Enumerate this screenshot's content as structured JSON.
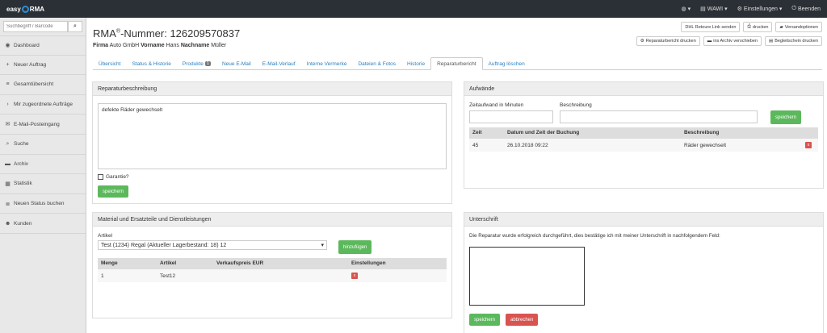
{
  "topbar": {
    "logo_left": "easy",
    "logo_right": "RMA",
    "nav": [
      {
        "icon": "globe-icon",
        "glyph": "◍",
        "label": ""
      },
      {
        "icon": "wawi-icon",
        "glyph": "▤",
        "label": "WAWI"
      },
      {
        "icon": "gear-icon",
        "glyph": "⚙",
        "label": "Einstellungen"
      },
      {
        "icon": "power-icon",
        "glyph": "⏻",
        "label": "Beenden"
      }
    ]
  },
  "sidebar": {
    "search_placeholder": "Suchbegriff / Barcode",
    "items": [
      {
        "icon": "dashboard-icon",
        "glyph": "◉",
        "label": "Dashboard"
      },
      {
        "icon": "plus-icon",
        "glyph": "+",
        "label": "Neuer Auftrag"
      },
      {
        "icon": "list-icon",
        "glyph": "≡",
        "label": "Gesamtübersicht"
      },
      {
        "icon": "chevron-right-icon",
        "glyph": "›",
        "label": "Mir zugeordnete Aufträge"
      },
      {
        "icon": "envelope-icon",
        "glyph": "✉",
        "label": "E-Mail-Posteingang"
      },
      {
        "icon": "search-icon",
        "glyph": "⌕",
        "label": "Suche"
      },
      {
        "icon": "archive-icon",
        "glyph": "▬",
        "label": "Archiv"
      },
      {
        "icon": "chart-icon",
        "glyph": "▦",
        "label": "Statistik"
      },
      {
        "icon": "list-icon",
        "glyph": "≣",
        "label": "Neuen Status buchen"
      },
      {
        "icon": "users-icon",
        "glyph": "☻",
        "label": "Kunden"
      }
    ]
  },
  "header": {
    "title_prefix": "RMA",
    "title_reg": "®",
    "title_suffix": "-Nummer: 126209570837",
    "firma_label": "Firma",
    "firma": "Auto GmbH",
    "vorname_label": "Vorname",
    "vorname": "Hans",
    "nachname_label": "Nachname",
    "nachname": "Müller",
    "buttons_row1": [
      {
        "label": "DHL Retoure Link senden",
        "glyph": ""
      },
      {
        "label": "drucken",
        "glyph": "⎙"
      },
      {
        "label": "Versandoptionen",
        "glyph": "▰"
      }
    ],
    "buttons_row2": [
      {
        "label": "Reparaturbericht drucken",
        "glyph": "⚙"
      },
      {
        "label": "ins Archiv verschieben",
        "glyph": "▬"
      },
      {
        "label": "Begleitschein drucken",
        "glyph": "▤"
      }
    ]
  },
  "tabs": [
    {
      "label": "Übersicht"
    },
    {
      "label": "Status & Historie"
    },
    {
      "label": "Produkte",
      "badge": "1"
    },
    {
      "label": "Neue E-Mail"
    },
    {
      "label": "E-Mail-Verlauf"
    },
    {
      "label": "Interne Vermerke"
    },
    {
      "label": "Dateien & Fotos"
    },
    {
      "label": "Historie"
    },
    {
      "label": "Reparaturbericht",
      "active": true
    },
    {
      "label": "Auftrag löschen"
    }
  ],
  "repair": {
    "heading": "Reparaturbeschreibung",
    "text": "defekte Räder gewechselt",
    "garantie_label": "Garantie?",
    "save": "speichern"
  },
  "effort": {
    "heading": "Aufwände",
    "time_label": "Zeitaufwand in Minuten",
    "desc_label": "Beschreibung",
    "save": "speichern",
    "columns": [
      "Zeit",
      "Datum und Zeit der Buchung",
      "Beschreibung",
      ""
    ],
    "rows": [
      {
        "zeit": "45",
        "datum": "26.10.2018 09:22",
        "beschreibung": "Räder gewechselt",
        "delete": "x"
      }
    ]
  },
  "material": {
    "heading": "Material und Ersatzteile und Dienstleistungen",
    "article_label": "Artikel",
    "article_value": "Test (1234) Regal (Aktueller Lagerbestand: 18) 12",
    "add": "hinzufügen",
    "columns": [
      "Menge",
      "Artikel",
      "Verkaufspreis EUR",
      "Einstellungen"
    ],
    "rows": [
      {
        "menge": "1",
        "artikel": "Test12",
        "preis": "",
        "delete": "x"
      }
    ]
  },
  "signature": {
    "heading": "Unterschrift",
    "text": "Die Reparatur wurde erfolgreich durchgeführt, dies bestätige ich mit meiner Unterschrift in nachfolgendem Feld:",
    "save": "speichern",
    "cancel": "abbrechen"
  }
}
